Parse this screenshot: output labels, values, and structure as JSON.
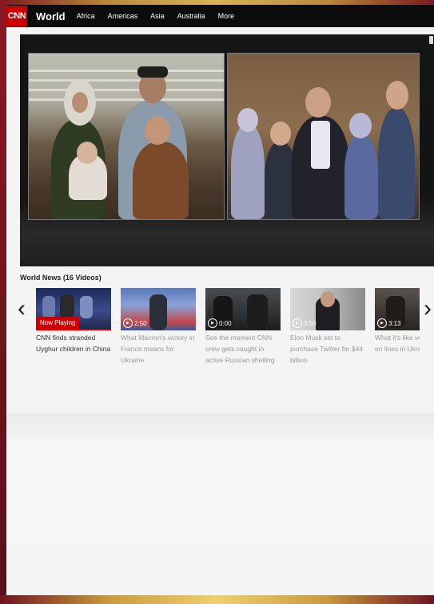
{
  "nav": {
    "logo": "CNN",
    "section": "World",
    "links": [
      "Africa",
      "Americas",
      "Asia",
      "Australia",
      "More"
    ]
  },
  "playlist": {
    "title": "World News (16 Videos)",
    "prev_icon": "chevron-left-icon",
    "next_icon": "chevron-right-icon",
    "videos": [
      {
        "badge": "Now Playing",
        "caption": "CNN finds stranded Uyghur children in China"
      },
      {
        "duration": "2:50",
        "caption": "What Macron's victory in France means for Ukraine"
      },
      {
        "duration": "0:00",
        "caption": "See the moment CNN crew gets caught in active Russian shelling"
      },
      {
        "duration": "3:50",
        "caption": "Elon Musk set to purchase Twitter for $44 billion"
      },
      {
        "duration": "3:13",
        "caption": "What it's like volunteer on lines in Ukrai"
      }
    ]
  },
  "colors": {
    "brand_red": "#cc0000",
    "nav_bg": "#0c0c0c",
    "frame": "#6e1420"
  }
}
